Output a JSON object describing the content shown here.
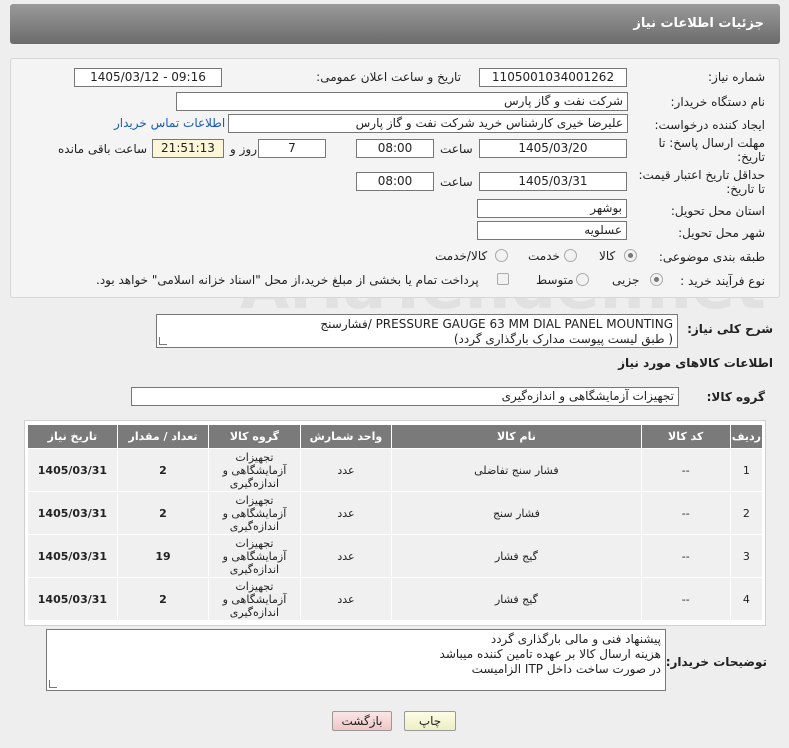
{
  "header": {
    "title": "جزئیات اطلاعات نیاز"
  },
  "watermark": "AriaTender.net",
  "form": {
    "need_number_label": "شماره نیاز:",
    "need_number": "1105001034001262",
    "announce_label": "تاریخ و ساعت اعلان عمومی:",
    "announce_value": "1405/03/12 - 09:16",
    "buyer_org_label": "نام دستگاه خریدار:",
    "buyer_org": "شرکت نفت و گاز پارس",
    "creator_label": "ایجاد کننده درخواست:",
    "creator": "علیرضا  خیری کارشناس خرید  شرکت نفت و گاز پارس",
    "contact_link": "اطلاعات تماس خریدار",
    "deadline_label_1": "مهلت ارسال پاسخ: تا",
    "deadline_label_2": "تاریخ:",
    "deadline_date": "1405/03/20",
    "time_label": "ساعت",
    "deadline_time": "08:00",
    "days_value": "7",
    "days_label": "روز و",
    "remaining_time": "21:51:13",
    "remaining_label": "ساعت باقی مانده",
    "validity_label_1": "حداقل تاریخ اعتبار قیمت:",
    "validity_label_2": "تا تاریخ:",
    "validity_date": "1405/03/31",
    "validity_time": "08:00",
    "province_label": "استان محل تحویل:",
    "province": "بوشهر",
    "city_label": "شهر محل تحویل:",
    "city": "عسلویه",
    "category_label": "طبقه بندی موضوعی:",
    "category_options": [
      "کالا",
      "خدمت",
      "کالا/خدمت"
    ],
    "category_selected": "کالا",
    "purchase_type_label": "نوع فرآیند خرید :",
    "purchase_options": [
      "جزیی",
      "متوسط"
    ],
    "purchase_selected": "جزیی",
    "payment_note": "پرداخت تمام یا بخشی از مبلغ خرید،از محل \"اسناد خزانه اسلامی\" خواهد بود."
  },
  "summary": {
    "label": "شرح کلی نیاز:",
    "line1": "PRESSURE GAUGE 63 MM DIAL PANEL MOUNTING /فشارسنج",
    "line2": "( طبق لیست پیوست مدارک بارگذاری گردد)"
  },
  "goods": {
    "section_title": "اطلاعات کالاهای مورد نیاز",
    "group_label": "گروه کالا:",
    "group_value": "تجهیزات آزمایشگاهی و اندازه‌گیری"
  },
  "table": {
    "headers": [
      "ردیف",
      "کد کالا",
      "نام کالا",
      "واحد شمارش",
      "گروه کالا",
      "تعداد / مقدار",
      "تاریخ نیاز"
    ],
    "rows": [
      {
        "index": "1",
        "code": "--",
        "name": "فشار سنج تفاضلی",
        "unit": "عدد",
        "group": [
          "تجهیزات",
          "آزمایشگاهی و",
          "اندازه‌گیری"
        ],
        "qty": "2",
        "date": "1405/03/31"
      },
      {
        "index": "2",
        "code": "--",
        "name": "فشار سنج",
        "unit": "عدد",
        "group": [
          "تجهیزات",
          "آزمایشگاهی و",
          "اندازه‌گیری"
        ],
        "qty": "2",
        "date": "1405/03/31"
      },
      {
        "index": "3",
        "code": "--",
        "name": "گیج فشار",
        "unit": "عدد",
        "group": [
          "تجهیزات",
          "آزمایشگاهی و",
          "اندازه‌گیری"
        ],
        "qty": "19",
        "date": "1405/03/31"
      },
      {
        "index": "4",
        "code": "--",
        "name": "گیج فشار",
        "unit": "عدد",
        "group": [
          "تجهیزات",
          "آزمایشگاهی و",
          "اندازه‌گیری"
        ],
        "qty": "2",
        "date": "1405/03/31"
      }
    ]
  },
  "buyer_notes": {
    "label": "توضیحات خریدار:",
    "line1": "پیشنهاد فنی و مالی بارگذاری گردد",
    "line2": "هزینه ارسال کالا بر عهده تامین کننده میباشد",
    "line3": "در صورت ساخت داخل ITP الزامیست"
  },
  "buttons": {
    "print": "چاپ",
    "back": "بازگشت"
  }
}
